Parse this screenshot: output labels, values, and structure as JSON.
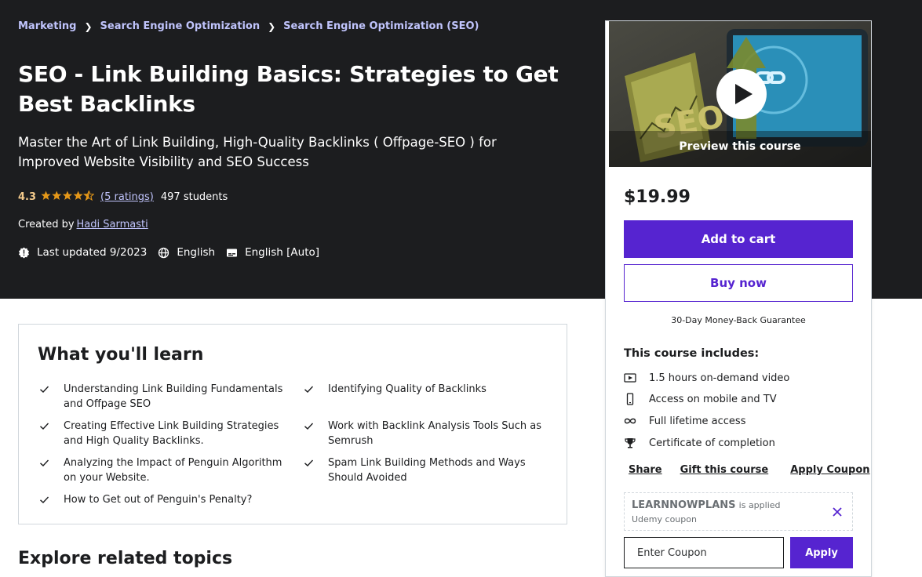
{
  "breadcrumb": [
    "Marketing",
    "Search Engine Optimization",
    "Search Engine Optimization (SEO)"
  ],
  "course": {
    "title": "SEO - Link Building Basics: Strategies to Get Best Backlinks",
    "subtitle": "Master the Art of Link Building, High-Quality Backlinks ( Offpage-SEO ) for Improved Website Visibility and SEO Success",
    "rating": "4.3",
    "rating_stars": 4.3,
    "ratings_link": "(5 ratings)",
    "students": "497 students",
    "created_by_label": "Created by",
    "instructor": "Hadi Sarmasti",
    "last_updated": "Last updated 9/2023",
    "language": "English",
    "captions": "English [Auto]"
  },
  "learn": {
    "title": "What you'll learn",
    "items": [
      "Understanding Link Building Fundamentals and Offpage SEO",
      "Identifying Quality of Backlinks",
      "Creating Effective Link Building Strategies and High Quality Backlinks.",
      "Work with Backlink Analysis Tools Such as Semrush",
      "Analyzing the Impact of Penguin Algorithm on your Website.",
      "Spam Link Building Methods and Ways Should Avoided",
      "How to Get out of Penguin's Penalty?"
    ]
  },
  "explore_title": "Explore related topics",
  "sidebar": {
    "preview_label": "Preview this course",
    "price": "$19.99",
    "add_to_cart": "Add to cart",
    "buy_now": "Buy now",
    "guarantee": "30-Day Money-Back Guarantee",
    "includes_title": "This course includes:",
    "includes": [
      {
        "icon": "video-icon",
        "label": "1.5 hours on-demand video"
      },
      {
        "icon": "mobile-icon",
        "label": "Access on mobile and TV"
      },
      {
        "icon": "infinity-icon",
        "label": "Full lifetime access"
      },
      {
        "icon": "trophy-icon",
        "label": "Certificate of completion"
      }
    ],
    "share": "Share",
    "gift": "Gift this course",
    "apply_coupon": "Apply Coupon",
    "coupon_code": "LEARNNOWPLANS",
    "coupon_applied_text": "is applied",
    "coupon_source": "Udemy coupon",
    "coupon_placeholder": "Enter Coupon",
    "apply": "Apply"
  },
  "colors": {
    "hero_bg": "#1c1d1f",
    "accent": "#5624d0",
    "link": "#c0c4fc",
    "star": "#e59819",
    "rating": "#f3ca8c"
  }
}
